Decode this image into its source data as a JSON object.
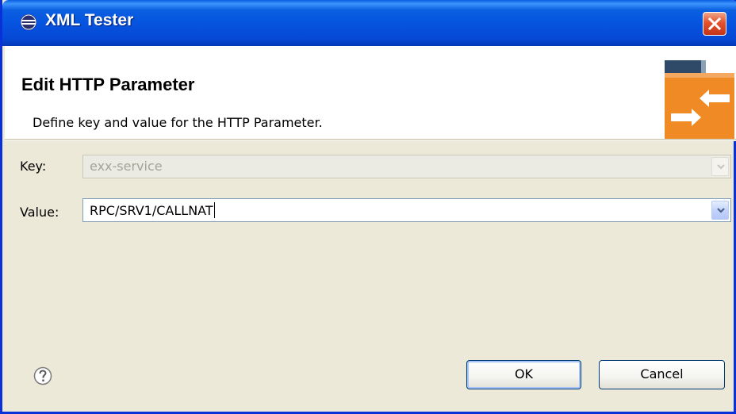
{
  "window": {
    "title": "XML Tester"
  },
  "header": {
    "title": "Edit HTTP Parameter",
    "description": "Define key and value for the HTTP Parameter."
  },
  "form": {
    "key_label": "Key:",
    "key_value": "exx-service",
    "key_disabled": true,
    "value_label": "Value:",
    "value_value": "RPC/SRV1/CALLNAT"
  },
  "buttons": {
    "ok_label": "OK",
    "cancel_label": "Cancel"
  },
  "colors": {
    "titlebar": "#0a5fe0",
    "close_button": "#e2512e",
    "banner_accent": "#f08a24",
    "window_background": "#ece9d8"
  },
  "icons": {
    "app": "eclipse-icon",
    "close": "close-icon",
    "banner": "exchange-arrows-icon",
    "help": "help-icon",
    "dropdown": "chevron-down-icon"
  }
}
